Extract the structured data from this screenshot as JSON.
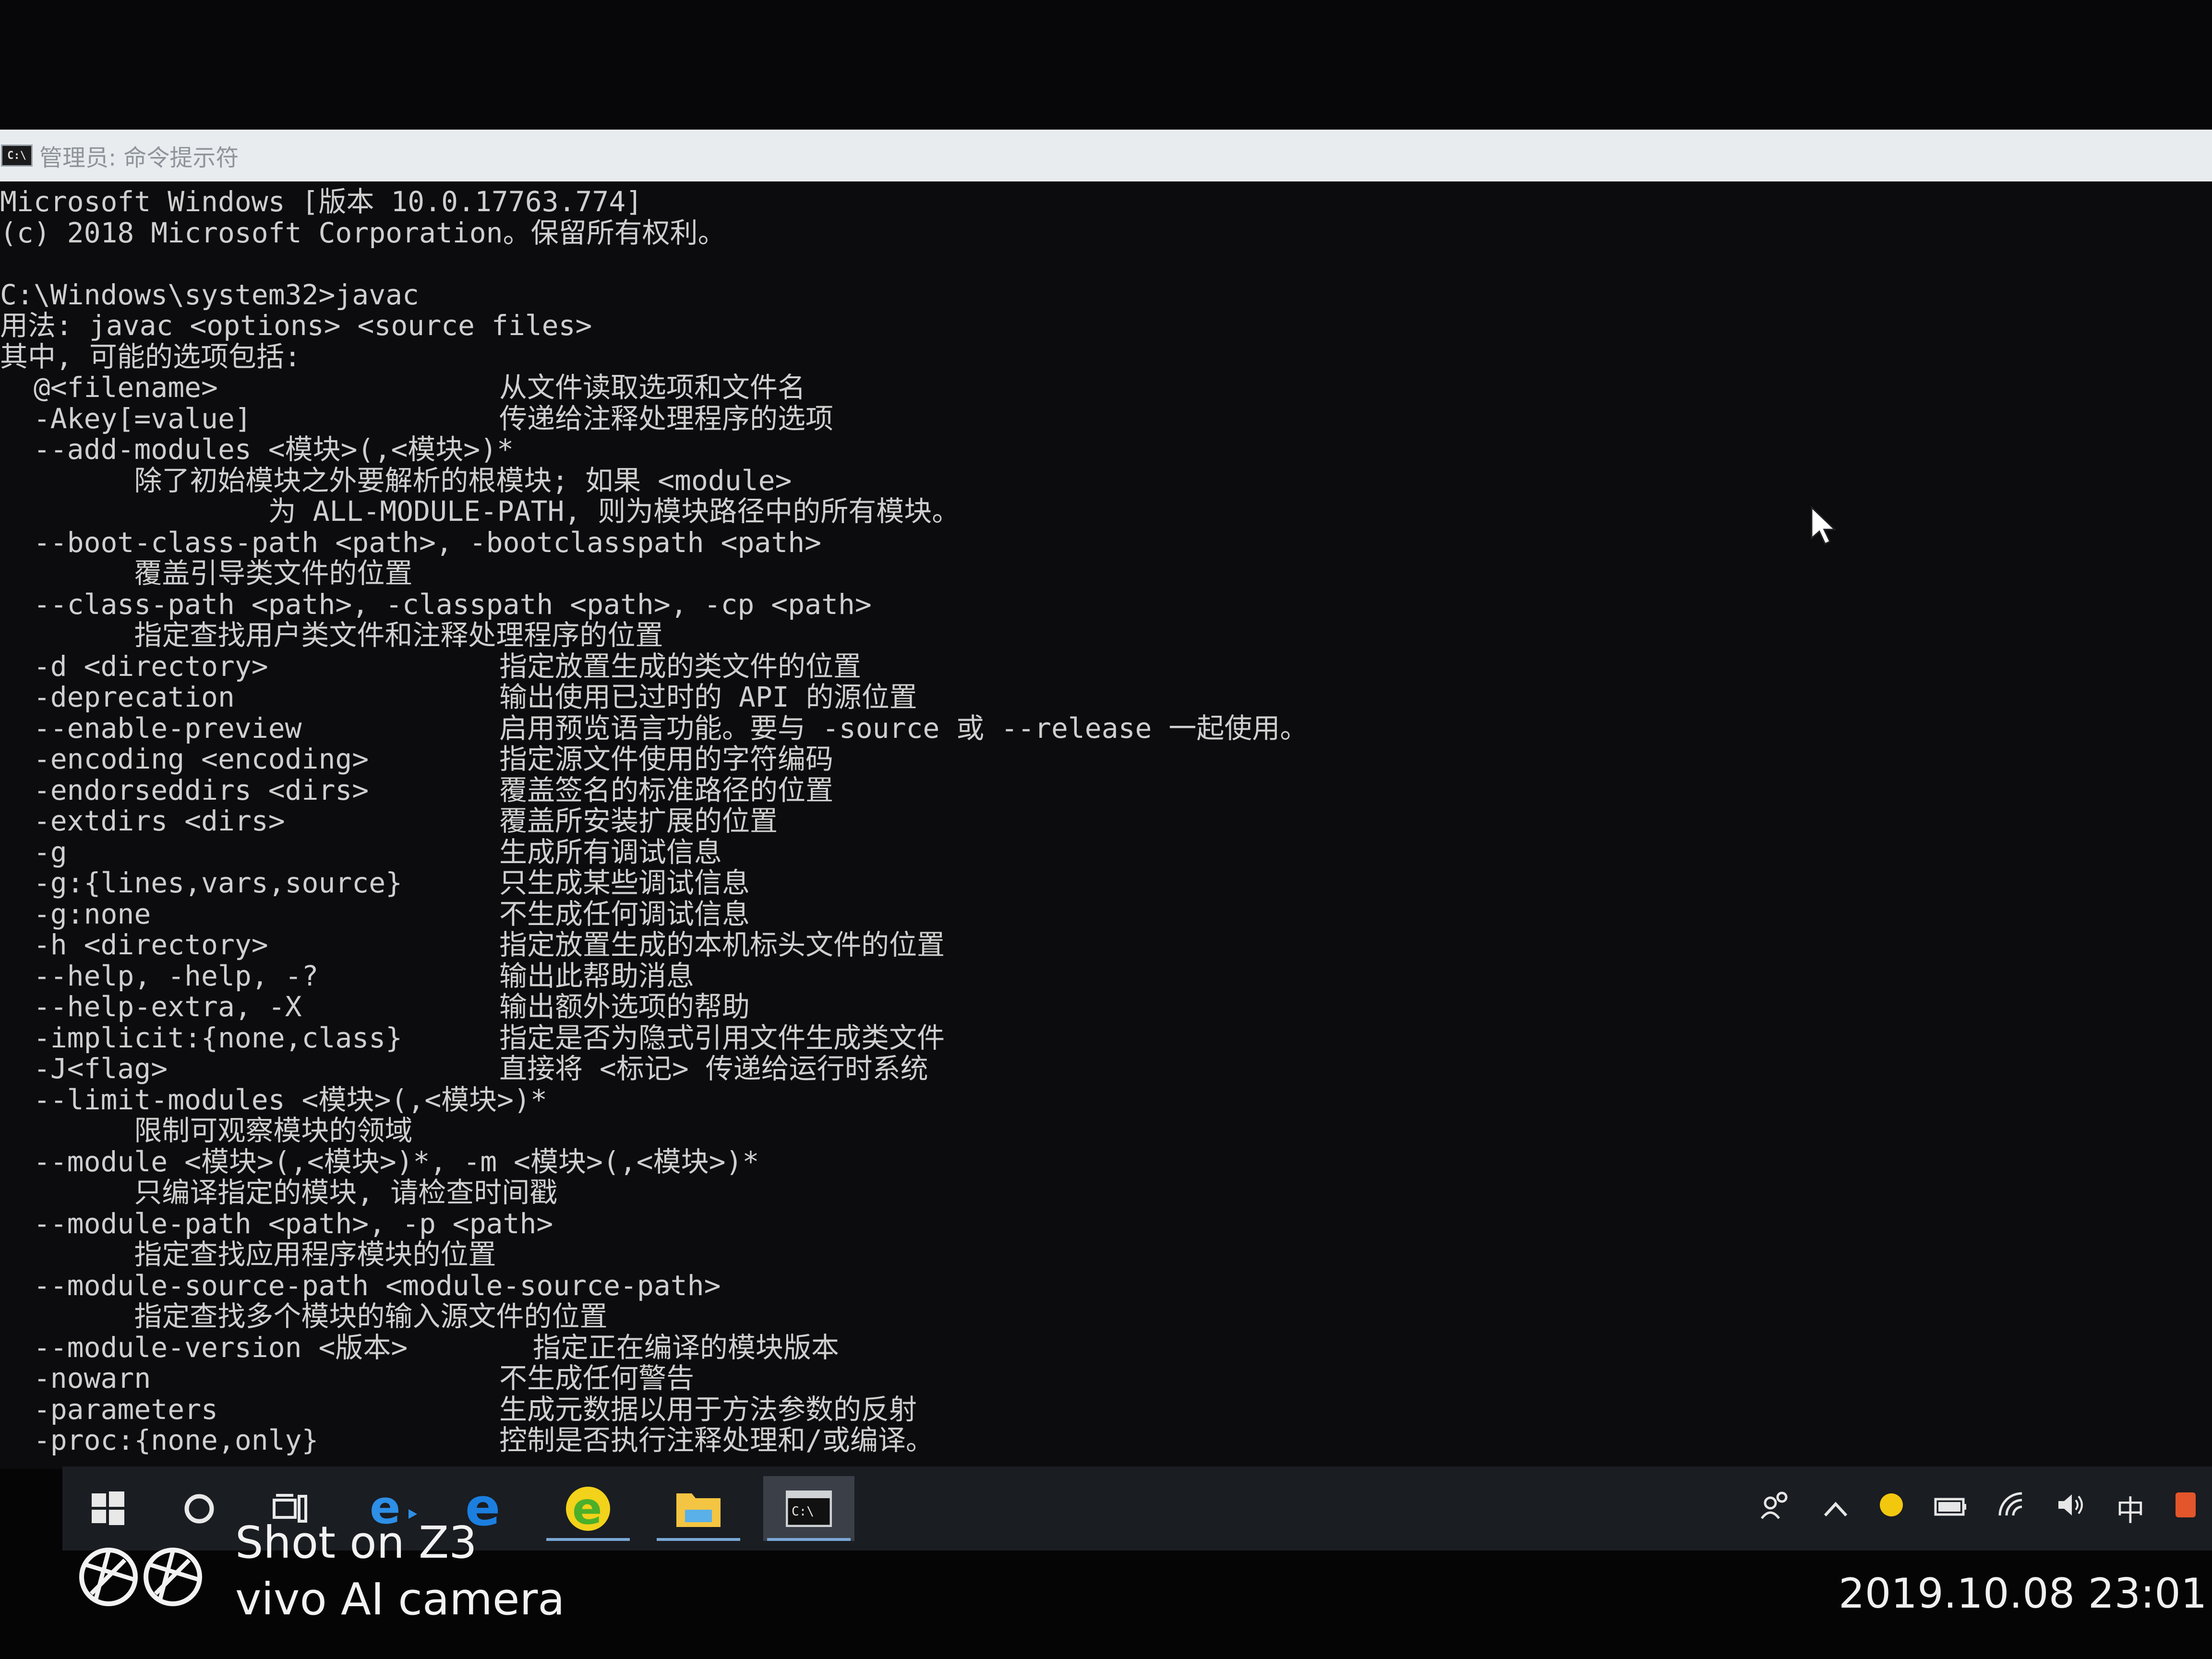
{
  "window": {
    "icon_text": "C:\\",
    "title": "管理员: 命令提示符"
  },
  "console": {
    "header": [
      "Microsoft Windows [版本 10.0.17763.774]",
      "(c) 2018 Microsoft Corporation。保留所有权利。",
      "",
      "C:\\Windows\\system32>javac",
      "用法: javac <options> <source files>",
      "其中, 可能的选项包括:"
    ],
    "options": [
      {
        "opt": "  @<filename>",
        "desc": "从文件读取选项和文件名"
      },
      {
        "opt": "  -Akey[=value]",
        "desc": "传递给注释处理程序的选项"
      },
      {
        "opt": "  --add-modules <模块>(,<模块>)*",
        "desc": ""
      },
      {
        "opt": "        除了初始模块之外要解析的根模块; 如果 <module>",
        "desc": ""
      },
      {
        "opt": "                为 ALL-MODULE-PATH, 则为模块路径中的所有模块。",
        "desc": ""
      },
      {
        "opt": "  --boot-class-path <path>, -bootclasspath <path>",
        "desc": ""
      },
      {
        "opt": "        覆盖引导类文件的位置",
        "desc": ""
      },
      {
        "opt": "  --class-path <path>, -classpath <path>, -cp <path>",
        "desc": ""
      },
      {
        "opt": "        指定查找用户类文件和注释处理程序的位置",
        "desc": ""
      },
      {
        "opt": "  -d <directory>",
        "desc": "指定放置生成的类文件的位置"
      },
      {
        "opt": "  -deprecation",
        "desc": "输出使用已过时的 API 的源位置"
      },
      {
        "opt": "  --enable-preview",
        "desc": "启用预览语言功能。要与 -source 或 --release 一起使用。"
      },
      {
        "opt": "  -encoding <encoding>",
        "desc": "指定源文件使用的字符编码"
      },
      {
        "opt": "  -endorseddirs <dirs>",
        "desc": "覆盖签名的标准路径的位置"
      },
      {
        "opt": "  -extdirs <dirs>",
        "desc": "覆盖所安装扩展的位置"
      },
      {
        "opt": "  -g",
        "desc": "生成所有调试信息"
      },
      {
        "opt": "  -g:{lines,vars,source}",
        "desc": "只生成某些调试信息"
      },
      {
        "opt": "  -g:none",
        "desc": "不生成任何调试信息"
      },
      {
        "opt": "  -h <directory>",
        "desc": "指定放置生成的本机标头文件的位置"
      },
      {
        "opt": "  --help, -help, -?",
        "desc": "输出此帮助消息"
      },
      {
        "opt": "  --help-extra, -X",
        "desc": "输出额外选项的帮助"
      },
      {
        "opt": "  -implicit:{none,class}",
        "desc": "指定是否为隐式引用文件生成类文件"
      },
      {
        "opt": "  -J<flag>",
        "desc": "直接将 <标记> 传递给运行时系统"
      },
      {
        "opt": "  --limit-modules <模块>(,<模块>)*",
        "desc": ""
      },
      {
        "opt": "        限制可观察模块的领域",
        "desc": ""
      },
      {
        "opt": "  --module <模块>(,<模块>)*, -m <模块>(,<模块>)*",
        "desc": ""
      },
      {
        "opt": "        只编译指定的模块, 请检查时间戳",
        "desc": ""
      },
      {
        "opt": "  --module-path <path>, -p <path>",
        "desc": ""
      },
      {
        "opt": "        指定查找应用程序模块的位置",
        "desc": ""
      },
      {
        "opt": "  --module-source-path <module-source-path>",
        "desc": ""
      },
      {
        "opt": "        指定查找多个模块的输入源文件的位置",
        "desc": ""
      },
      {
        "opt": "  --module-version <版本>",
        "desc": "  指定正在编译的模块版本"
      },
      {
        "opt": "  -nowarn",
        "desc": "不生成任何警告"
      },
      {
        "opt": "  -parameters",
        "desc": "生成元数据以用于方法参数的反射"
      },
      {
        "opt": "  -proc:{none,only}",
        "desc": "控制是否执行注释处理和/或编译。"
      }
    ]
  },
  "taskbar": {
    "items": [
      {
        "icon": "windows-start-icon"
      },
      {
        "icon": "cortana-circle-icon"
      },
      {
        "icon": "task-view-icon"
      },
      {
        "icon": "ie-edge-icon"
      },
      {
        "icon": "edge-icon"
      },
      {
        "icon": "360-browser-icon"
      },
      {
        "icon": "file-explorer-icon"
      },
      {
        "icon": "command-prompt-icon"
      }
    ],
    "tray": {
      "ime": "中"
    }
  },
  "overlay": {
    "brand_line1": "Shot on Z3",
    "brand_line2": "vivo AI camera",
    "timestamp": "2019.10.08 23:01"
  },
  "colors": {
    "console_bg": "#0c0c0e",
    "console_text": "#cfcfcf",
    "titlebar_bg": "#e9ecef",
    "taskbar_bg": "#1a1d22",
    "active_indicator": "#7aa8d6"
  }
}
